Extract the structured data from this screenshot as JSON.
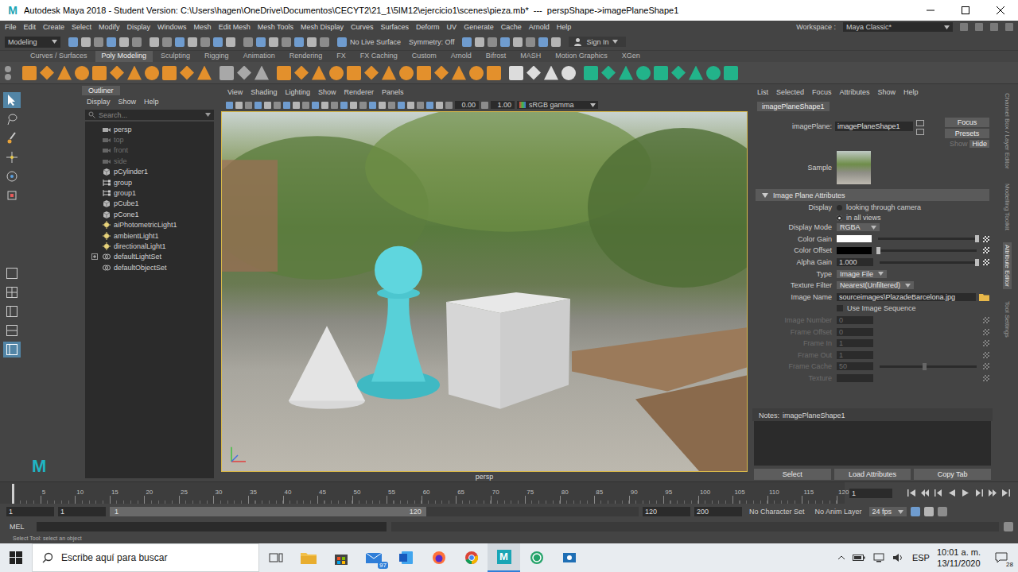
{
  "window": {
    "logo": "M",
    "title": "Autodesk Maya 2018 - Student Version: C:\\Users\\hagen\\OneDrive\\Documentos\\CECYT2\\21_1\\5IM12\\ejercicio1\\scenes\\pieza.mb*  ---  perspShape->imagePlaneShape1"
  },
  "menu_bar": {
    "items": [
      "File",
      "Edit",
      "Create",
      "Select",
      "Modify",
      "Display",
      "Windows",
      "Mesh",
      "Edit Mesh",
      "Mesh Tools",
      "Mesh Display",
      "Curves",
      "Surfaces",
      "Deform",
      "UV",
      "Generate",
      "Cache",
      "Arnold",
      "Help"
    ],
    "workspace_label": "Workspace :",
    "workspace_value": "Maya Classic*"
  },
  "status_line": {
    "mode": "Modeling",
    "live_surface": "No Live Surface",
    "symmetry": "Symmetry: Off",
    "sign_in": "Sign In"
  },
  "shelf": {
    "tabs": [
      {
        "label": "Curves / Surfaces",
        "selected": false
      },
      {
        "label": "Poly Modeling",
        "selected": true
      },
      {
        "label": "Sculpting",
        "selected": false
      },
      {
        "label": "Rigging",
        "selected": false
      },
      {
        "label": "Animation",
        "selected": false
      },
      {
        "label": "Rendering",
        "selected": false
      },
      {
        "label": "FX",
        "selected": false
      },
      {
        "label": "FX Caching",
        "selected": false
      },
      {
        "label": "Custom",
        "selected": false
      },
      {
        "label": "Arnold",
        "selected": false
      },
      {
        "label": "Bifrost",
        "selected": false
      },
      {
        "label": "MASH",
        "selected": false
      },
      {
        "label": "Motion Graphics",
        "selected": false
      },
      {
        "label": "XGen",
        "selected": false
      }
    ]
  },
  "outliner": {
    "title": "Outliner",
    "menu": [
      "Display",
      "Show",
      "Help"
    ],
    "search_placeholder": "Search...",
    "items": [
      {
        "name": "persp",
        "kind": "camera",
        "hidden": false,
        "expandable": false
      },
      {
        "name": "top",
        "kind": "camera",
        "hidden": true,
        "expandable": false
      },
      {
        "name": "front",
        "kind": "camera",
        "hidden": true,
        "expandable": false
      },
      {
        "name": "side",
        "kind": "camera",
        "hidden": true,
        "expandable": false
      },
      {
        "name": "pCylinder1",
        "kind": "mesh",
        "hidden": false,
        "expandable": false
      },
      {
        "name": "group",
        "kind": "group",
        "hidden": false,
        "expandable": false
      },
      {
        "name": "group1",
        "kind": "group",
        "hidden": false,
        "expandable": false
      },
      {
        "name": "pCube1",
        "kind": "mesh",
        "hidden": false,
        "expandable": false
      },
      {
        "name": "pCone1",
        "kind": "mesh",
        "hidden": false,
        "expandable": false
      },
      {
        "name": "aiPhotometricLight1",
        "kind": "light",
        "hidden": false,
        "expandable": false
      },
      {
        "name": "ambientLight1",
        "kind": "light",
        "hidden": false,
        "expandable": false
      },
      {
        "name": "directionalLight1",
        "kind": "light",
        "hidden": false,
        "expandable": false
      },
      {
        "name": "defaultLightSet",
        "kind": "set",
        "hidden": false,
        "expandable": true
      },
      {
        "name": "defaultObjectSet",
        "kind": "set",
        "hidden": false,
        "expandable": false
      }
    ]
  },
  "viewport": {
    "menu": [
      "View",
      "Shading",
      "Lighting",
      "Show",
      "Renderer",
      "Panels"
    ],
    "exposure": "0.00",
    "gamma": "1.00",
    "color_space": "sRGB gamma",
    "camera": "persp"
  },
  "attribute_editor": {
    "menu": [
      "List",
      "Selected",
      "Focus",
      "Attributes",
      "Show",
      "Help"
    ],
    "tab": "imagePlaneShape1",
    "node_label": "imagePlane:",
    "node_value": "imagePlaneShape1",
    "buttons": [
      "Focus",
      "Presets"
    ],
    "show_label": "Show",
    "hide_button": "Hide",
    "sample_label": "Sample",
    "section": {
      "title": "Image Plane Attributes",
      "expanded": true
    },
    "rows": [
      {
        "kind": "radio",
        "label": "Display",
        "disabled": false,
        "options": [
          {
            "label": "looking through camera",
            "selected": false
          },
          {
            "label": "in all views",
            "selected": true
          }
        ]
      },
      {
        "kind": "dropdown",
        "label": "Display Mode",
        "value": "RGBA",
        "disabled": false
      },
      {
        "kind": "color",
        "label": "Color Gain",
        "color": "#ffffff",
        "level": 1,
        "disabled": false
      },
      {
        "kind": "color",
        "label": "Color Offset",
        "color": "#000000",
        "level": 0,
        "disabled": false
      },
      {
        "kind": "slider",
        "label": "Alpha Gain",
        "value": "1.000",
        "level": 1,
        "disabled": false
      },
      {
        "kind": "dropdown",
        "label": "Type",
        "value": "Image File",
        "disabled": false
      },
      {
        "kind": "dropdown",
        "label": "Texture Filter",
        "value": "Nearest(Unfiltered)",
        "disabled": false
      },
      {
        "kind": "file",
        "label": "Image Name",
        "value": "sourceimages\\PlazadeBarcelona.jpg",
        "disabled": false
      },
      {
        "kind": "checkbox",
        "label": "Use Image Sequence",
        "checked": false,
        "disabled": false
      },
      {
        "kind": "field",
        "label": "Image Number",
        "value": "0",
        "disabled": true
      },
      {
        "kind": "field",
        "label": "Frame Offset",
        "value": "0",
        "disabled": true
      },
      {
        "kind": "field",
        "label": "Frame In",
        "value": "1",
        "disabled": true
      },
      {
        "kind": "field",
        "label": "Frame Out",
        "value": "1",
        "disabled": true
      },
      {
        "kind": "slider",
        "label": "Frame Cache",
        "value": "50",
        "level": 0.46,
        "disabled": true
      },
      {
        "kind": "field",
        "label": "Texture",
        "value": "",
        "disabled": true
      }
    ],
    "notes_label": "Notes:",
    "notes_node": "imagePlaneShape1",
    "bottom_buttons": [
      "Select",
      "Load Attributes",
      "Copy Tab"
    ]
  },
  "side_tabs": [
    {
      "label": "Channel Box / Layer Editor",
      "selected": false
    },
    {
      "label": "Modelling Toolkit",
      "selected": false
    },
    {
      "label": "Attribute Editor",
      "selected": true
    },
    {
      "label": "Tool Settings",
      "selected": false
    }
  ],
  "time_slider": {
    "ticks": [
      "5",
      "10",
      "15",
      "20",
      "25",
      "30",
      "35",
      "40",
      "45",
      "50",
      "55",
      "60",
      "65",
      "70",
      "75",
      "80",
      "85",
      "90",
      "95",
      "100",
      "105",
      "110",
      "115",
      "120"
    ],
    "current_frame": "1"
  },
  "range_slider": {
    "start": "1",
    "playback_start": "1",
    "bar_start": "1",
    "bar_end": "120",
    "playback_end": "120",
    "end": "200",
    "character_set": "No Character Set",
    "anim_layer": "No Anim Layer",
    "fps": "24 fps"
  },
  "command_line": {
    "language": "MEL"
  },
  "help_line": {
    "text": "Select Tool: select an object"
  },
  "taskbar": {
    "search_placeholder": "Escribe aquí para buscar",
    "mail_badge": "97",
    "language": "ESP",
    "time": "10:01 a. m.",
    "date": "13/11/2020",
    "notifications": "28"
  }
}
